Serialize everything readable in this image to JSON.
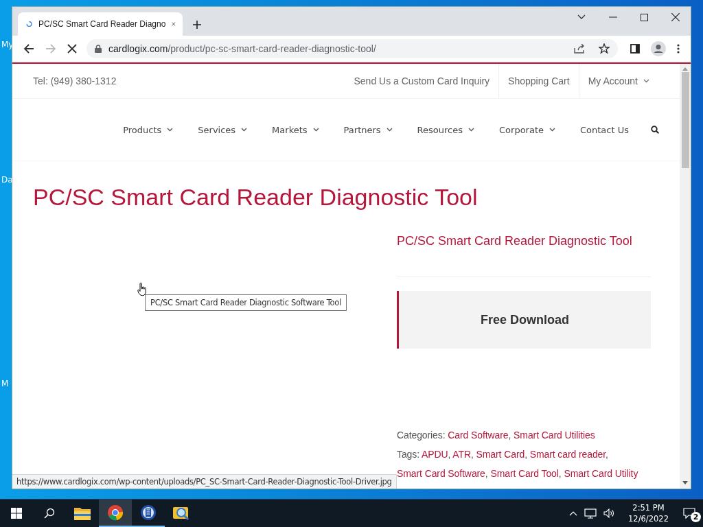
{
  "desktop": {
    "icon_labels": [
      "My",
      "Da",
      "M"
    ]
  },
  "browser": {
    "tabs": [
      {
        "title": "PC/SC Smart Card Reader Diagno",
        "loading": true,
        "selected": true
      }
    ],
    "toolbar": {
      "back_enabled": true,
      "forward_enabled": false,
      "domain": "cardlogix.com",
      "path": "/product/pc-sc-smart-card-reader-diagnostic-tool/"
    },
    "status_url": "https://www.cardlogix.com/wp-content/uploads/PC_SC-Smart-Card-Reader-Diagnostic-Tool-Driver.jpg"
  },
  "site": {
    "phone": "Tel: (949) 380-1312",
    "top_links": [
      {
        "label": "Send Us a Custom Card Inquiry",
        "dropdown": false
      },
      {
        "label": "Shopping Cart",
        "dropdown": false
      },
      {
        "label": "My Account",
        "dropdown": true
      }
    ],
    "nav": [
      {
        "label": "Products",
        "dropdown": true
      },
      {
        "label": "Services",
        "dropdown": true
      },
      {
        "label": "Markets",
        "dropdown": true
      },
      {
        "label": "Partners",
        "dropdown": true
      },
      {
        "label": "Resources",
        "dropdown": true
      },
      {
        "label": "Corporate",
        "dropdown": true
      },
      {
        "label": "Contact Us",
        "dropdown": false
      }
    ]
  },
  "product": {
    "title": "PC/SC Smart Card Reader Diagnostic Tool",
    "image_tooltip": "PC/SC Smart Card Reader Diagnostic Software Tool",
    "name": "PC/SC Smart Card Reader Diagnostic Tool",
    "download_button": "Free Download",
    "link_separator": ", ",
    "categories": {
      "label": "Categories:",
      "links": [
        "Card Software",
        "Smart Card Utilities"
      ]
    },
    "tags": {
      "label": "Tags:",
      "links": [
        "APDU",
        "ATR",
        "Smart Card",
        "Smart card reader",
        "Smart Card Software",
        "Smart Card Tool",
        "Smart Card Utility"
      ]
    }
  },
  "taskbar": {
    "apps": [
      {
        "kind": "folder",
        "running": false,
        "selected": false
      },
      {
        "kind": "chrome",
        "running": true,
        "selected": true
      },
      {
        "kind": "reader",
        "running": true,
        "selected": false
      },
      {
        "kind": "magnifier",
        "running": false,
        "selected": false
      }
    ],
    "time": "2:51 PM",
    "date": "12/6/2022",
    "notification_count": "2"
  }
}
